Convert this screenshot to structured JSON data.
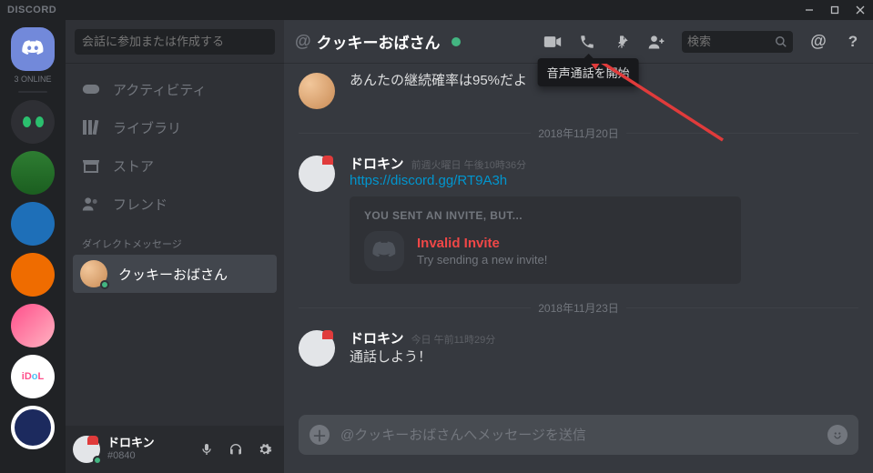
{
  "brand": "DISCORD",
  "servers": {
    "online_label": "3 ONLINE"
  },
  "sidebar": {
    "search_placeholder": "会話に参加または作成する",
    "nav": [
      {
        "label": "アクティビティ"
      },
      {
        "label": "ライブラリ"
      },
      {
        "label": "ストア"
      },
      {
        "label": "フレンド"
      }
    ],
    "dm_header": "ダイレクトメッセージ",
    "dms": [
      {
        "name": "クッキーおばさん"
      }
    ]
  },
  "user_panel": {
    "name": "ドロキン",
    "tag": "#0840"
  },
  "chat_header": {
    "at": "@",
    "name": "クッキーおばさん",
    "search_placeholder": "検索",
    "tooltip": "音声通話を開始"
  },
  "messages": {
    "m0": {
      "text": "あんたの継続確率は95%だよ"
    },
    "d1": {
      "label": "2018年11月20日"
    },
    "m1": {
      "user": "ドロキン",
      "time": "前週火曜日 午後10時36分",
      "link": "https://discord.gg/RT9A3h"
    },
    "invite": {
      "title": "YOU SENT AN INVITE, BUT...",
      "bad": "Invalid Invite",
      "sub": "Try sending a new invite!"
    },
    "d2": {
      "label": "2018年11月23日"
    },
    "m2": {
      "user": "ドロキン",
      "time": "今日 午前11時29分",
      "text": "通話しよう！"
    }
  },
  "input": {
    "placeholder": "@クッキーおばさんへメッセージを送信"
  }
}
